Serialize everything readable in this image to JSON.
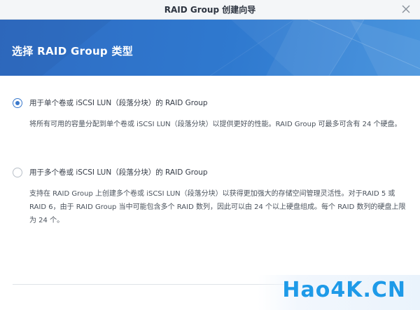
{
  "window": {
    "title": "RAID Group 创建向导",
    "close_icon": "close-icon"
  },
  "banner": {
    "heading": "选择 RAID Group 类型",
    "colors": {
      "from": "#2f6cc3",
      "to": "#3f8fdc"
    }
  },
  "options": [
    {
      "label": "用于单个卷或 iSCSI LUN（段落分块）的 RAID Group",
      "description": "将所有可用的容量分配到单个卷或 iSCSI LUN（段落分块）以提供更好的性能。RAID Group 可最多可含有 24 个硬盘。",
      "selected": true
    },
    {
      "label": "用于多个卷或 iSCSI LUN（段落分块）的 RAID Group",
      "description": "支持在 RAID Group 上创建多个卷或 iSCSI LUN（段落分块）以获得更加强大的存储空间管理灵活性。对于RAID 5 或 RAID 6，由于 RAID Group 当中可能包含多个 RAID 数列，因此可以由 24 个以上硬盘组成。每个 RAID 数列的硬盘上限为 24 个。",
      "selected": false
    }
  ],
  "accent_color": "#3a79cc",
  "watermark": {
    "text": "Hao4K.CN"
  }
}
